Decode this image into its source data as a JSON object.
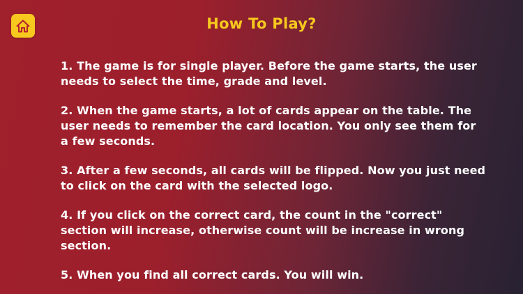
{
  "header": {
    "title": "How To Play?",
    "home_icon": "home-icon"
  },
  "rules": [
    "1. The game is for single player. Before the game starts, the user needs to select the time, grade and level.",
    "2. When the game starts, a lot of cards appear on the table. The user needs to remember the card location. You only see them for a few seconds.",
    "3. After a few seconds, all cards will be flipped. Now you just need to click on the card with the selected logo.",
    "4. If you click on the correct card, the count in the \"correct\" section will increase, otherwise count will be increase in wrong section.",
    "5. When you find all correct cards. You will win."
  ],
  "colors": {
    "accent": "#f7c81e",
    "text": "#ffffff",
    "background_start": "#a0202c",
    "background_end": "#282232"
  }
}
